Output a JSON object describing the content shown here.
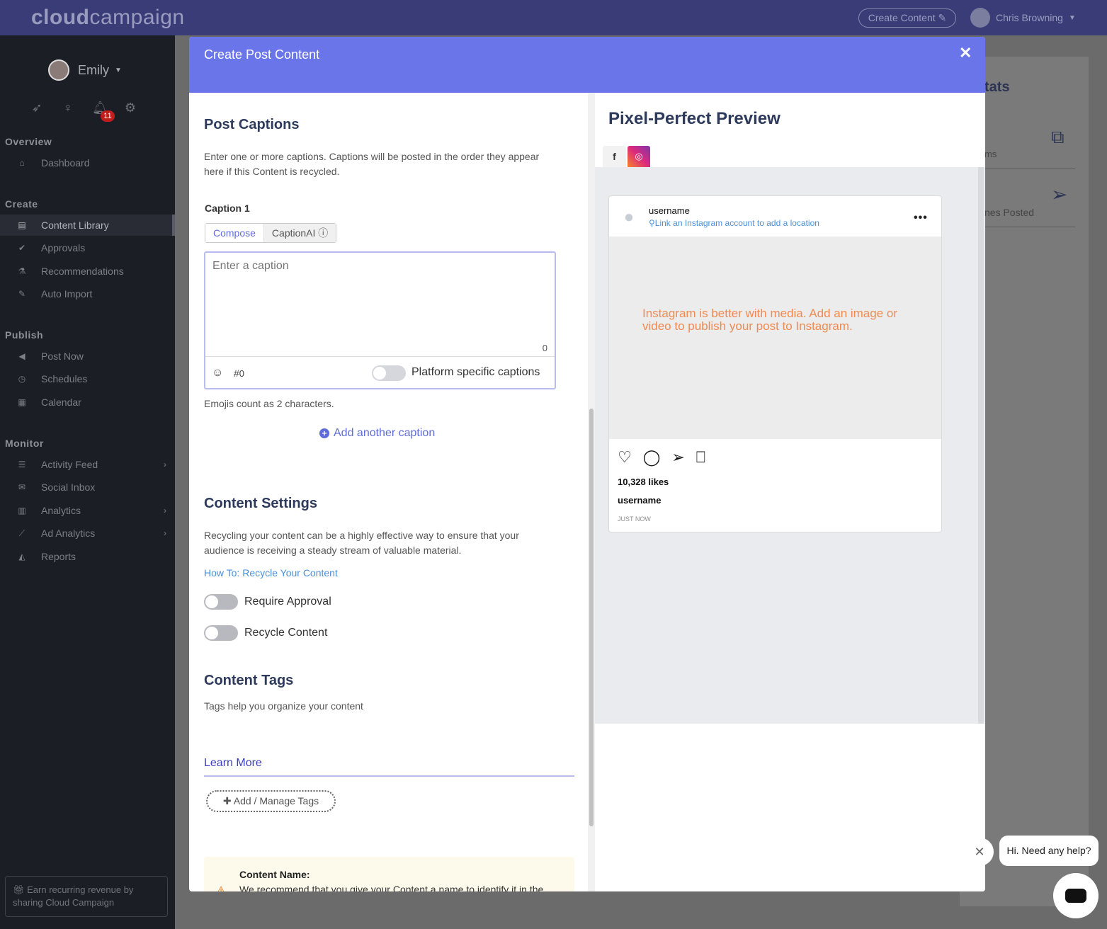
{
  "topbar": {
    "logo_bold": "cloud",
    "logo_light": "campaign",
    "create_button": "Create Content ✎",
    "user_name": "Chris Browning"
  },
  "sidebar": {
    "account_name": "Emily",
    "notification_count": "11",
    "sections": {
      "overview": "Overview",
      "create": "Create",
      "publish": "Publish",
      "monitor": "Monitor"
    },
    "items": {
      "dashboard": "Dashboard",
      "content_library": "Content Library",
      "approvals": "Approvals",
      "recommendations": "Recommendations",
      "auto_import": "Auto Import",
      "post_now": "Post Now",
      "schedules": "Schedules",
      "calendar": "Calendar",
      "activity_feed": "Activity Feed",
      "social_inbox": "Social Inbox",
      "analytics": "Analytics",
      "ad_analytics": "Ad Analytics",
      "reports": "Reports"
    },
    "earn_text": "Earn recurring revenue by sharing Cloud Campaign"
  },
  "background": {
    "stats_title": "tats",
    "items_label": "ms",
    "times_posted": "nes Posted"
  },
  "modal": {
    "title": "Create Post Content",
    "close": "✕",
    "post_captions": {
      "heading": "Post Captions",
      "description": "Enter one or more captions. Captions will be posted in the order they appear here if this Content is recycled.",
      "caption_label": "Caption 1",
      "tab_compose": "Compose",
      "tab_captionai": "CaptionAI",
      "placeholder": "Enter a caption",
      "char_count": "0",
      "hashtag_count": "0",
      "platform_specific_label": "Platform specific captions",
      "emoji_note": "Emojis count as 2 characters.",
      "add_caption": "Add another caption"
    },
    "content_settings": {
      "heading": "Content Settings",
      "description": "Recycling your content can be a highly effective way to ensure that your audience is receiving a steady stream of valuable material.",
      "howto_link": "How To: Recycle Your Content",
      "require_approval": "Require Approval",
      "recycle_content": "Recycle Content"
    },
    "content_tags": {
      "heading": "Content Tags",
      "description": "Tags help you organize your content",
      "learn_more": "Learn More",
      "manage_button": "Add / Manage Tags"
    },
    "notice": {
      "title": "Content Name:",
      "text": "We recommend that you give your Content a name to identify it in the Content Library."
    },
    "preview": {
      "heading": "Pixel-Perfect Preview",
      "username": "username",
      "location_hint": "Link an Instagram account to add a location",
      "media_message": "Instagram is better with media. Add an image or video to publish your post to Instagram.",
      "likes": "10,328 likes",
      "caption_user": "username",
      "time": "JUST NOW"
    }
  },
  "chat": {
    "bubble": "Hi. Need any help?",
    "close": "✕"
  }
}
